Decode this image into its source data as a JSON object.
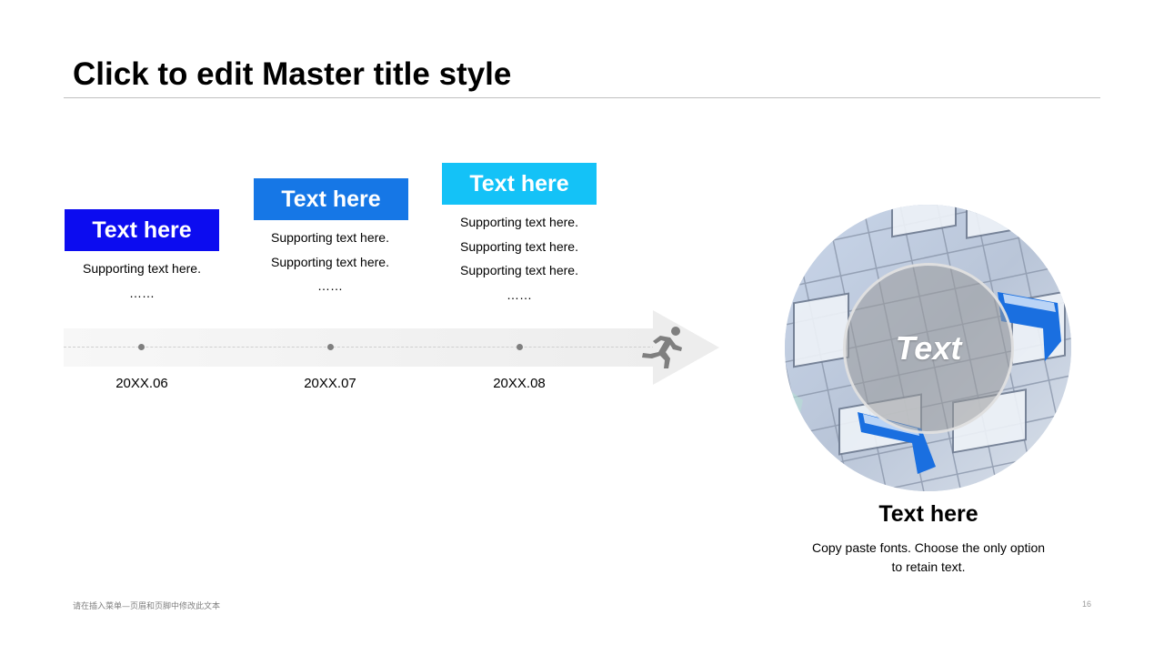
{
  "slide": {
    "title": "Click to edit Master title style",
    "footer_note": "请在插入菜单—页眉和页脚中修改此文本",
    "page_number": "16"
  },
  "colors": {
    "milestone_1": "#0c0cf0",
    "milestone_2": "#1677e6",
    "milestone_3": "#14c2f7",
    "timeline": "#ededed",
    "dot": "#7f7f7f",
    "runner_icon": "#7f7f7f"
  },
  "timeline": {
    "milestones": [
      {
        "label": "Text here",
        "lines": [
          "Supporting text here.",
          "……"
        ],
        "date": "20XX.06"
      },
      {
        "label": "Text here",
        "lines": [
          "Supporting text here.",
          "Supporting text here.",
          "……"
        ],
        "date": "20XX.07"
      },
      {
        "label": "Text here",
        "lines": [
          "Supporting text here.",
          "Supporting text here.",
          "Supporting text here.",
          "……"
        ],
        "date": "20XX.08"
      }
    ],
    "end_icon": "running-person-icon"
  },
  "feature": {
    "overlay_text": "Text",
    "title": "Text here",
    "description": "Copy paste fonts. Choose the only option to retain text."
  }
}
